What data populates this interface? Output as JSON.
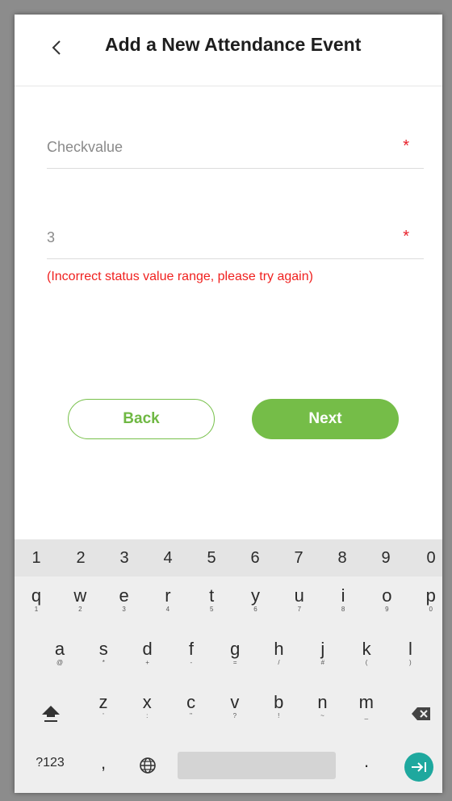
{
  "header": {
    "title": "Add a New Attendance Event"
  },
  "form": {
    "checkvalue_placeholder": "Checkvalue",
    "status_value": "3",
    "required_mark": "*",
    "error_message": "(Incorrect status value range, please try again)"
  },
  "buttons": {
    "back_label": "Back",
    "next_label": "Next"
  },
  "keyboard": {
    "number_row": [
      "1",
      "2",
      "3",
      "4",
      "5",
      "6",
      "7",
      "8",
      "9",
      "0"
    ],
    "row1": [
      {
        "main": "q",
        "sub": "1"
      },
      {
        "main": "w",
        "sub": "2"
      },
      {
        "main": "e",
        "sub": "3"
      },
      {
        "main": "r",
        "sub": "4"
      },
      {
        "main": "t",
        "sub": "5"
      },
      {
        "main": "y",
        "sub": "6"
      },
      {
        "main": "u",
        "sub": "7"
      },
      {
        "main": "i",
        "sub": "8"
      },
      {
        "main": "o",
        "sub": "9"
      },
      {
        "main": "p",
        "sub": "0"
      }
    ],
    "row2": [
      {
        "main": "a",
        "sub": "@"
      },
      {
        "main": "s",
        "sub": "*"
      },
      {
        "main": "d",
        "sub": "+"
      },
      {
        "main": "f",
        "sub": "-"
      },
      {
        "main": "g",
        "sub": "="
      },
      {
        "main": "h",
        "sub": "/"
      },
      {
        "main": "j",
        "sub": "#"
      },
      {
        "main": "k",
        "sub": "("
      },
      {
        "main": "l",
        "sub": ")"
      }
    ],
    "row3": [
      {
        "main": "z",
        "sub": "'"
      },
      {
        "main": "x",
        "sub": ":"
      },
      {
        "main": "c",
        "sub": "\""
      },
      {
        "main": "v",
        "sub": "?"
      },
      {
        "main": "b",
        "sub": "!"
      },
      {
        "main": "n",
        "sub": "~"
      },
      {
        "main": "m",
        "sub": "_"
      }
    ],
    "symbols_label": "?123",
    "comma_label": ",",
    "period_label": ".",
    "icons": {
      "shift": "shift-icon",
      "backspace": "backspace-icon",
      "globe": "globe-icon",
      "enter": "enter-icon",
      "back": "chevron-left-icon"
    }
  },
  "colors": {
    "accent_green": "#75bd48",
    "error_red": "#f0211f",
    "enter_teal": "#1ea89e"
  }
}
